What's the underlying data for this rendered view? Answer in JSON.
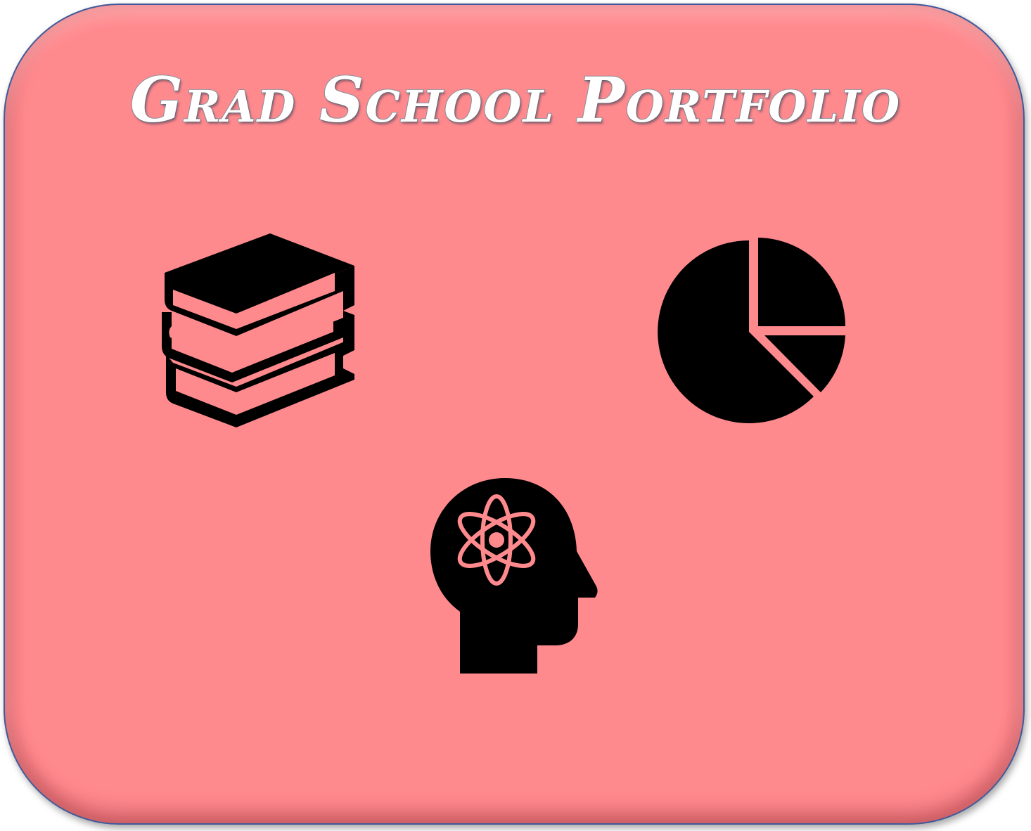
{
  "title": "Grad School Portfolio",
  "colors": {
    "card_background": "#ff8a8e",
    "card_border": "#41599a",
    "title_fill": "#ffffff",
    "icon_fill": "#000000"
  },
  "icons": [
    {
      "name": "books-icon"
    },
    {
      "name": "pie-chart-icon"
    },
    {
      "name": "head-atom-icon"
    }
  ]
}
